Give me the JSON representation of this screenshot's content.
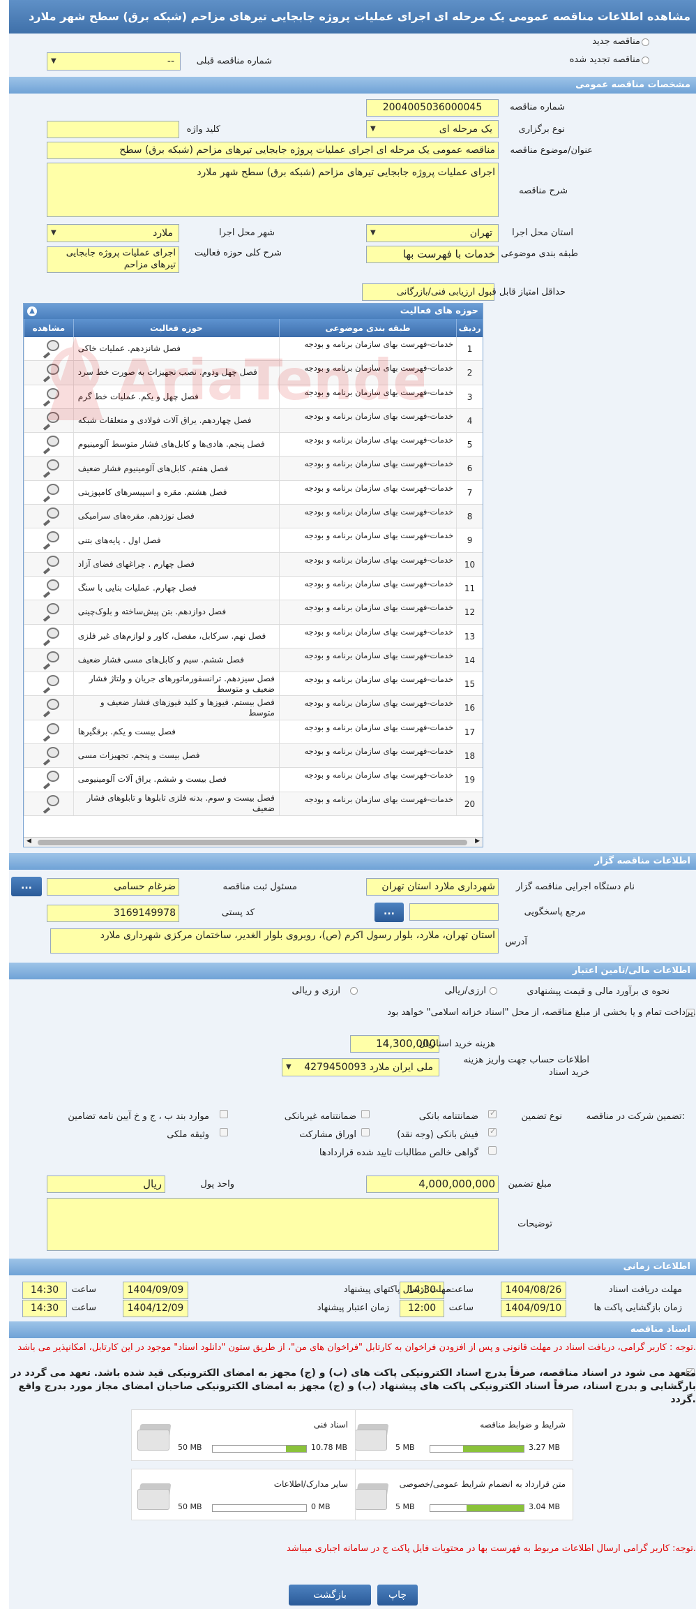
{
  "title": "مشاهده اطلاعات مناقصه عمومی یک مرحله ای اجرای عملیات پروژه جابجایی تیرهای مزاحم (شبکه برق) سطح شهر ملارد",
  "top": {
    "new_tender": "مناقصه جدید",
    "renewed_tender": "مناقصه تجدید شده",
    "prev_tender_label": "شماره مناقصه قبلی",
    "prev_tender_value": "--"
  },
  "general": {
    "header": "مشخصات مناقصه عمومی",
    "number_label": "شماره مناقصه",
    "number_value": "2004005036000045",
    "type_label": "نوع برگزاری",
    "type_value": "یک مرحله ای",
    "keyword_label": "کلید واژه",
    "keyword_value": "",
    "subject_label": "عنوان/موضوع مناقصه",
    "subject_value": "مناقصه عمومی یک مرحله ای اجرای عملیات پروژه جابجایی تیرهای مزاحم (شبکه برق) سطح",
    "desc_label": "شرح مناقصه",
    "desc_value": "اجرای عملیات پروژه جابجایی تیرهای مزاحم (شبکه برق) سطح شهر ملارد",
    "province_label": "استان محل اجرا",
    "province_value": "تهران",
    "city_label": "شهر محل اجرا",
    "city_value": "ملارد",
    "category_label": "طبقه بندی موضوعی",
    "category_value": "خدمات با فهرست بها",
    "scope_label": "شرح کلی حوزه فعالیت",
    "scope_value": "اجرای عملیات پروژه جابجایی تیرهای مزاحم",
    "min_score_label": "حداقل امتیاز قابل قبول ارزیابی فنی/بازرگانی",
    "min_score_value": ""
  },
  "activities": {
    "title": "حوزه های فعالیت",
    "col_no": "ردیف",
    "col_category": "طبقه بندی موضوعی",
    "col_activity": "حوزه فعالیت",
    "col_view": "مشاهده",
    "rows": [
      {
        "no": "1",
        "category": "خدمات-فهرست بهای سازمان برنامه و بودجه",
        "activity": "فصل شانزدهم. عملیات خاکی"
      },
      {
        "no": "2",
        "category": "خدمات-فهرست بهای سازمان برنامه و بودجه",
        "activity": "فصل چهل ودوم. نصب تجهیزات به صورت خط سرد"
      },
      {
        "no": "3",
        "category": "خدمات-فهرست بهای سازمان برنامه و بودجه",
        "activity": "فصل چهل و یکم. عملیات خط گرم"
      },
      {
        "no": "4",
        "category": "خدمات-فهرست بهای سازمان برنامه و بودجه",
        "activity": "فصل چهاردهم. یراق آلات فولادی و متعلقات شبکه"
      },
      {
        "no": "5",
        "category": "خدمات-فهرست بهای سازمان برنامه و بودجه",
        "activity": "فصل پنجم. هادی‌ها و کابل‌های فشار متوسط آلومینیوم"
      },
      {
        "no": "6",
        "category": "خدمات-فهرست بهای سازمان برنامه و بودجه",
        "activity": "فصل هفتم. کابل‌های آلومینیوم فشار ضعیف"
      },
      {
        "no": "7",
        "category": "خدمات-فهرست بهای سازمان برنامه و بودجه",
        "activity": "فصل هشتم. مقره و اسپیسرهای کامپوزیتی"
      },
      {
        "no": "8",
        "category": "خدمات-فهرست بهای سازمان برنامه و بودجه",
        "activity": "فصل نوزدهم. مقره‌های سرامیکی"
      },
      {
        "no": "9",
        "category": "خدمات-فهرست بهای سازمان برنامه و بودجه",
        "activity": "فصل اول . پایه‌های بتنی"
      },
      {
        "no": "10",
        "category": "خدمات-فهرست بهای سازمان برنامه و بودجه",
        "activity": "فصل چهارم . چراغهای فضای آزاد"
      },
      {
        "no": "11",
        "category": "خدمات-فهرست بهای سازمان برنامه و بودجه",
        "activity": "فصل چهارم. عملیات بنایی با سنگ"
      },
      {
        "no": "12",
        "category": "خدمات-فهرست بهای سازمان برنامه و بودجه",
        "activity": "فصل دوازدهم. بتن پیش‌ساخته و بلوک‌چینی"
      },
      {
        "no": "13",
        "category": "خدمات-فهرست بهای سازمان برنامه و بودجه",
        "activity": "فصل نهم. سرکابل، مفصل، کاور و لوازم‌های غیر فلزی"
      },
      {
        "no": "14",
        "category": "خدمات-فهرست بهای سازمان برنامه و بودجه",
        "activity": "فصل ششم. سیم و کابل‌های مسی فشار ضعیف"
      },
      {
        "no": "15",
        "category": "خدمات-فهرست بهای سازمان برنامه و بودجه",
        "activity": "فصل سیزدهم. ترانسفورماتورهای جریان و ولتاژ فشار ضعیف و متوسط"
      },
      {
        "no": "16",
        "category": "خدمات-فهرست بهای سازمان برنامه و بودجه",
        "activity": "فصل بیستم. فیوزها و کلید فیوزهای فشار ضعیف و متوسط"
      },
      {
        "no": "17",
        "category": "خدمات-فهرست بهای سازمان برنامه و بودجه",
        "activity": "فصل بیست و یکم. برقگیرها"
      },
      {
        "no": "18",
        "category": "خدمات-فهرست بهای سازمان برنامه و بودجه",
        "activity": "فصل بیست و پنجم. تجهیزات مسی"
      },
      {
        "no": "19",
        "category": "خدمات-فهرست بهای سازمان برنامه و بودجه",
        "activity": "فصل بیست و ششم. یراق آلات آلومینیومی"
      },
      {
        "no": "20",
        "category": "خدمات-فهرست بهای سازمان برنامه و بودجه",
        "activity": "فصل بیست و سوم. بدنه فلزی تابلوها و تابلوهای فشار ضعیف"
      }
    ]
  },
  "organizer": {
    "header": "اطلاعات مناقصه گزار",
    "org_label": "نام دستگاه اجرایی مناقصه گزار",
    "org_value": "شهرداری ملارد استان تهران",
    "resp_label": "مسئول ثبت مناقصه",
    "resp_value": "ضرغام حسامی",
    "ref_label": "مرجع پاسخگویی",
    "ref_value": "",
    "postal_label": "کد پستی",
    "postal_value": "3169149978",
    "address_label": "آدرس",
    "address_value": "استان تهران، ملارد، بلوار رسول اکرم (ص)، روبروی بلوار الغدیر، ساختمان مرکزی شهرداری ملارد",
    "more_button": "..."
  },
  "financial": {
    "header": "اطلاعات مالی/تامین اعتبار",
    "estimate_label": "نحوه ی برآورد مالی و قیمت پیشنهادی",
    "opt_rial_currency": "ارزی/ریالی",
    "opt_currency_rial": "ارزی و ریالی",
    "treasury_text": "پرداخت تمام و یا بخشی از مبلغ مناقصه، از محل \"اسناد خزانه اسلامی\" خواهد بود.",
    "doc_fee_label": "هزینه خرید اسناد",
    "doc_fee_value": "14,300,000",
    "doc_fee_unit": "ریال",
    "account_label": "اطلاعات حساب جهت واریز هزینه خرید اسناد",
    "account_value": "ملی ایران ملارد 4279450093"
  },
  "guarantee": {
    "label": "تضمین شرکت در مناقصه:",
    "type_label": "نوع تضمین",
    "opt_bank_guarantee": "ضمانتنامه بانکی",
    "opt_nonbank_guarantee": "ضمانتنامه غیربانکی",
    "opt_regulation": "موارد بند ب ، ج و خ آیین نامه تضامین",
    "opt_bank_receipt": "فیش بانکی (وجه نقد)",
    "opt_participation": "اوراق مشارکت",
    "opt_property": "وثیقه ملکی",
    "opt_claims": "گواهی خالص مطالبات تایید شده قراردادها",
    "amount_label": "مبلغ تضمین",
    "amount_value": "4,000,000,000",
    "currency_label": "واحد پول",
    "currency_value": "ریال",
    "notes_label": "توضیحات",
    "notes_value": ""
  },
  "timing": {
    "header": "اطلاعات زمانی",
    "doc_deadline_label": "مهلت دریافت اسناد",
    "doc_deadline_date": "1404/08/26",
    "doc_deadline_time": "14:30",
    "submit_deadline_label": "مهلت ارسال پاکتهای پیشنهاد",
    "submit_deadline_date": "1404/09/09",
    "submit_deadline_time": "14:30",
    "opening_label": "زمان بازگشایی پاکت ها",
    "opening_date": "1404/09/10",
    "opening_time": "12:00",
    "validity_label": "زمان اعتبار پیشنهاد",
    "validity_date": "1404/12/09",
    "validity_time": "14:30",
    "time_label": "ساعت"
  },
  "documents": {
    "header": "اسناد مناقصه",
    "notice": "توجه : کاربر گرامی، دریافت اسناد در مهلت قانونی و پس از افزودن فراخوان به کارتابل \"فراخوان های من\"، از طریق ستون \"دانلود اسناد\" موجود در این کارتابل، امکانپذیر می باشد.",
    "commitment": "متعهد می شود در اسناد مناقصه، صرفاً بدرج اسناد الکترونیکی پاکت های (ب) و (ج) مجهز به امضای الکترونیکی قید شده باشد. تعهد می گردد در بارگشایی و بدرج اسناد، صرفاً اسناد الکترونیکی پاکت های پیشنهاد (ب) و (ج) مجهز به امضای الکترونیکی صاحبان امضای مجاز مورد بدرج واقع گردد.",
    "files": [
      {
        "name": "شرایط و ضوابط مناقصه",
        "used": "3.27 MB",
        "max": "5 MB",
        "fraction": 0.65
      },
      {
        "name": "اسناد فنی",
        "used": "10.78 MB",
        "max": "50 MB",
        "fraction": 0.22
      },
      {
        "name": "متن قرارداد به انضمام شرایط عمومی/خصوصی",
        "used": "3.04 MB",
        "max": "5 MB",
        "fraction": 0.61
      },
      {
        "name": "سایر مدارک/اطلاعات",
        "used": "0 MB",
        "max": "50 MB",
        "fraction": 0
      }
    ],
    "bottom_notice": "توجه: کاربر گرامی ارسال اطلاعات مربوط به فهرست بها در محتویات فایل پاکت ج در سامانه اجباری میباشد."
  },
  "actions": {
    "print": "چاپ",
    "back": "بازگشت"
  },
  "colors": {
    "header_blue": "#6fa2d6",
    "field_yellow": "#ffffa8",
    "notice_red": "#e00000",
    "progress_green": "#8ac23a"
  }
}
